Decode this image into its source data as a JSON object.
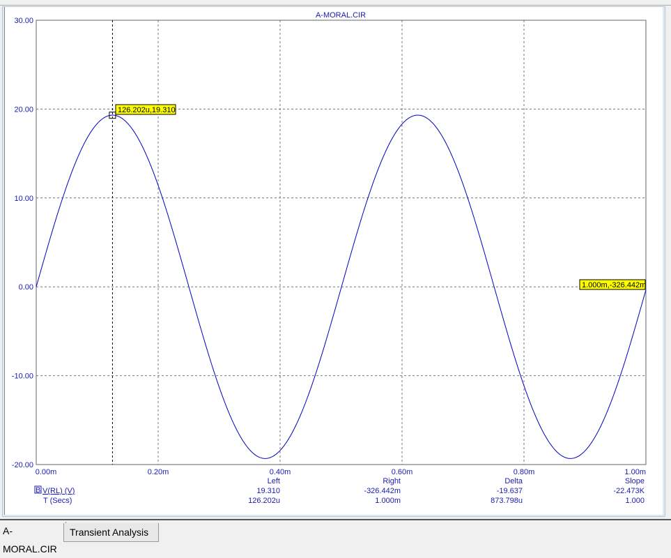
{
  "window": {
    "tabs": [
      {
        "label": "A-MORAL.CIR"
      },
      {
        "label": "Transient Analysis",
        "active": true
      }
    ]
  },
  "colors": {
    "trace": "#0000c0",
    "label_text": "#1a1ab0",
    "cursor_label_bg": "#ffff00"
  },
  "chart_data": {
    "type": "line",
    "title": "A-MORAL.CIR",
    "xlabel": "T (Secs)",
    "ylabel": "V(RL) (V)",
    "xlim": [
      0,
      0.001
    ],
    "ylim": [
      -20,
      30
    ],
    "x_ticks": [
      "0.00m",
      "0.20m",
      "0.40m",
      "0.60m",
      "0.80m",
      "1.00m"
    ],
    "y_ticks": [
      "30.00",
      "20.00",
      "10.00",
      "0.00",
      "-10.00",
      "-20.00"
    ],
    "grid": true,
    "series": [
      {
        "name": "V(RL) (V)",
        "function": "sine",
        "amplitude": 19.32,
        "frequency_hz": 2000,
        "phase_deg": -1.0,
        "t_start": 0,
        "t_end": 0.001
      }
    ],
    "cursors": {
      "left": {
        "t": 0.000126202,
        "v": 19.31,
        "label": "126.202u,19.310"
      },
      "right": {
        "t": 0.001,
        "v": -0.326442,
        "label": "1.000m,-326.442m"
      }
    }
  },
  "readout": {
    "headers": [
      "Left",
      "Right",
      "Delta",
      "Slope"
    ],
    "series_badge": "B",
    "rows": [
      {
        "name": "V(RL) (V)",
        "values": [
          "19.310",
          "-326.442m",
          "-19.637",
          "-22.473K"
        ]
      },
      {
        "name": "T (Secs)",
        "values": [
          "126.202u",
          "1.000m",
          "873.798u",
          "1.000"
        ]
      }
    ]
  }
}
